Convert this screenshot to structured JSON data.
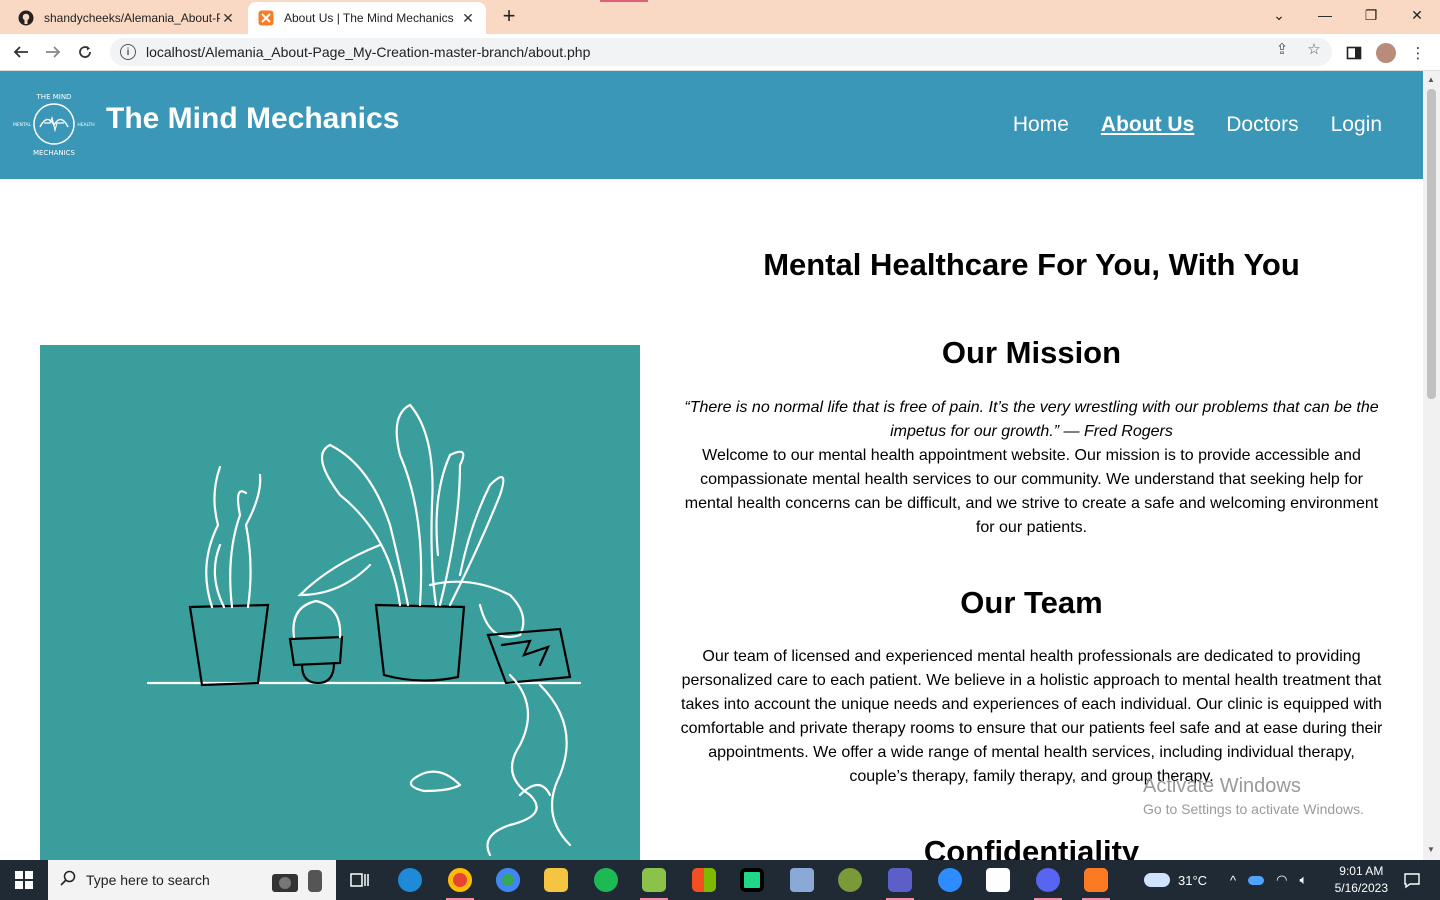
{
  "browser": {
    "tabs": [
      {
        "title": "shandycheeks/Alemania_About-P",
        "icon": "github-icon"
      },
      {
        "title": "About Us | The Mind Mechanics",
        "icon": "xampp-icon",
        "active": true
      }
    ],
    "url": "localhost/Alemania_About-Page_My-Creation-master-branch/about.php"
  },
  "site": {
    "title": "The Mind Mechanics",
    "logo_text": {
      "top": "THE MIND",
      "left": "MENTAL",
      "right": "HEALTH",
      "bottom": "MECHANICS"
    },
    "nav": [
      {
        "label": "Home",
        "active": false
      },
      {
        "label": "About Us",
        "active": true
      },
      {
        "label": "Doctors",
        "active": false
      },
      {
        "label": "Login",
        "active": false
      }
    ]
  },
  "main": {
    "heading": "Mental Healthcare For You, With You",
    "mission": {
      "heading": "Our Mission",
      "quote": "“There is no normal life that is free of pain. It’s the very wrestling with our problems that can be the impetus for our growth.” — Fred Rogers",
      "text": "Welcome to our mental health appointment website. Our mission is to provide accessible and compassionate mental health services to our community. We understand that seeking help for mental health concerns can be difficult, and we strive to create a safe and welcoming environment for our patients."
    },
    "team": {
      "heading": "Our Team",
      "text": "Our team of licensed and experienced mental health professionals are dedicated to providing personalized care to each patient. We believe in a holistic approach to mental health treatment that takes into account the unique needs and experiences of each individual. Our clinic is equipped with comfortable and private therapy rooms to ensure that our patients feel safe and at ease during their appointments. We offer a wide range of mental health services, including individual therapy, couple’s therapy, family therapy, and group therapy."
    },
    "confidentiality_heading": "Confidentiality"
  },
  "watermark": {
    "line1": "Activate Windows",
    "line2": "Go to Settings to activate Windows."
  },
  "taskbar": {
    "search_placeholder": "Type here to search",
    "weather": "31°C",
    "time": "9:01 AM",
    "date": "5/16/2023"
  },
  "colors": {
    "header": "#3b97b8",
    "illustration_bg": "#3a9e9d",
    "tabbar": "#f9d9c4"
  }
}
